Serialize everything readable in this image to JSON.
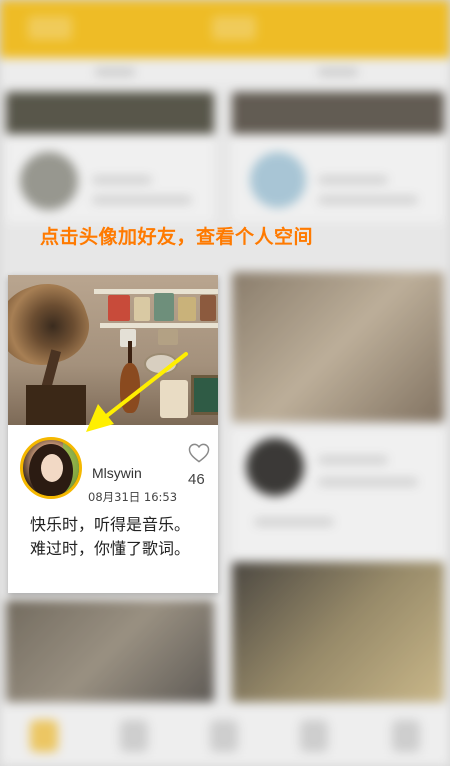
{
  "hint": {
    "text": "点击头像加好友，查看个人空间",
    "color": "#ff7a00"
  },
  "colors": {
    "accent": "#f5b800",
    "arrow": "#ffef00"
  },
  "card": {
    "username": "Mlsywin",
    "timestamp": "08月31日 16:53",
    "likes": "46",
    "caption": "快乐时，听得是音乐。难过时，你懂了歌词。",
    "icons": {
      "like": "heart-icon",
      "avatar": "avatar"
    }
  }
}
